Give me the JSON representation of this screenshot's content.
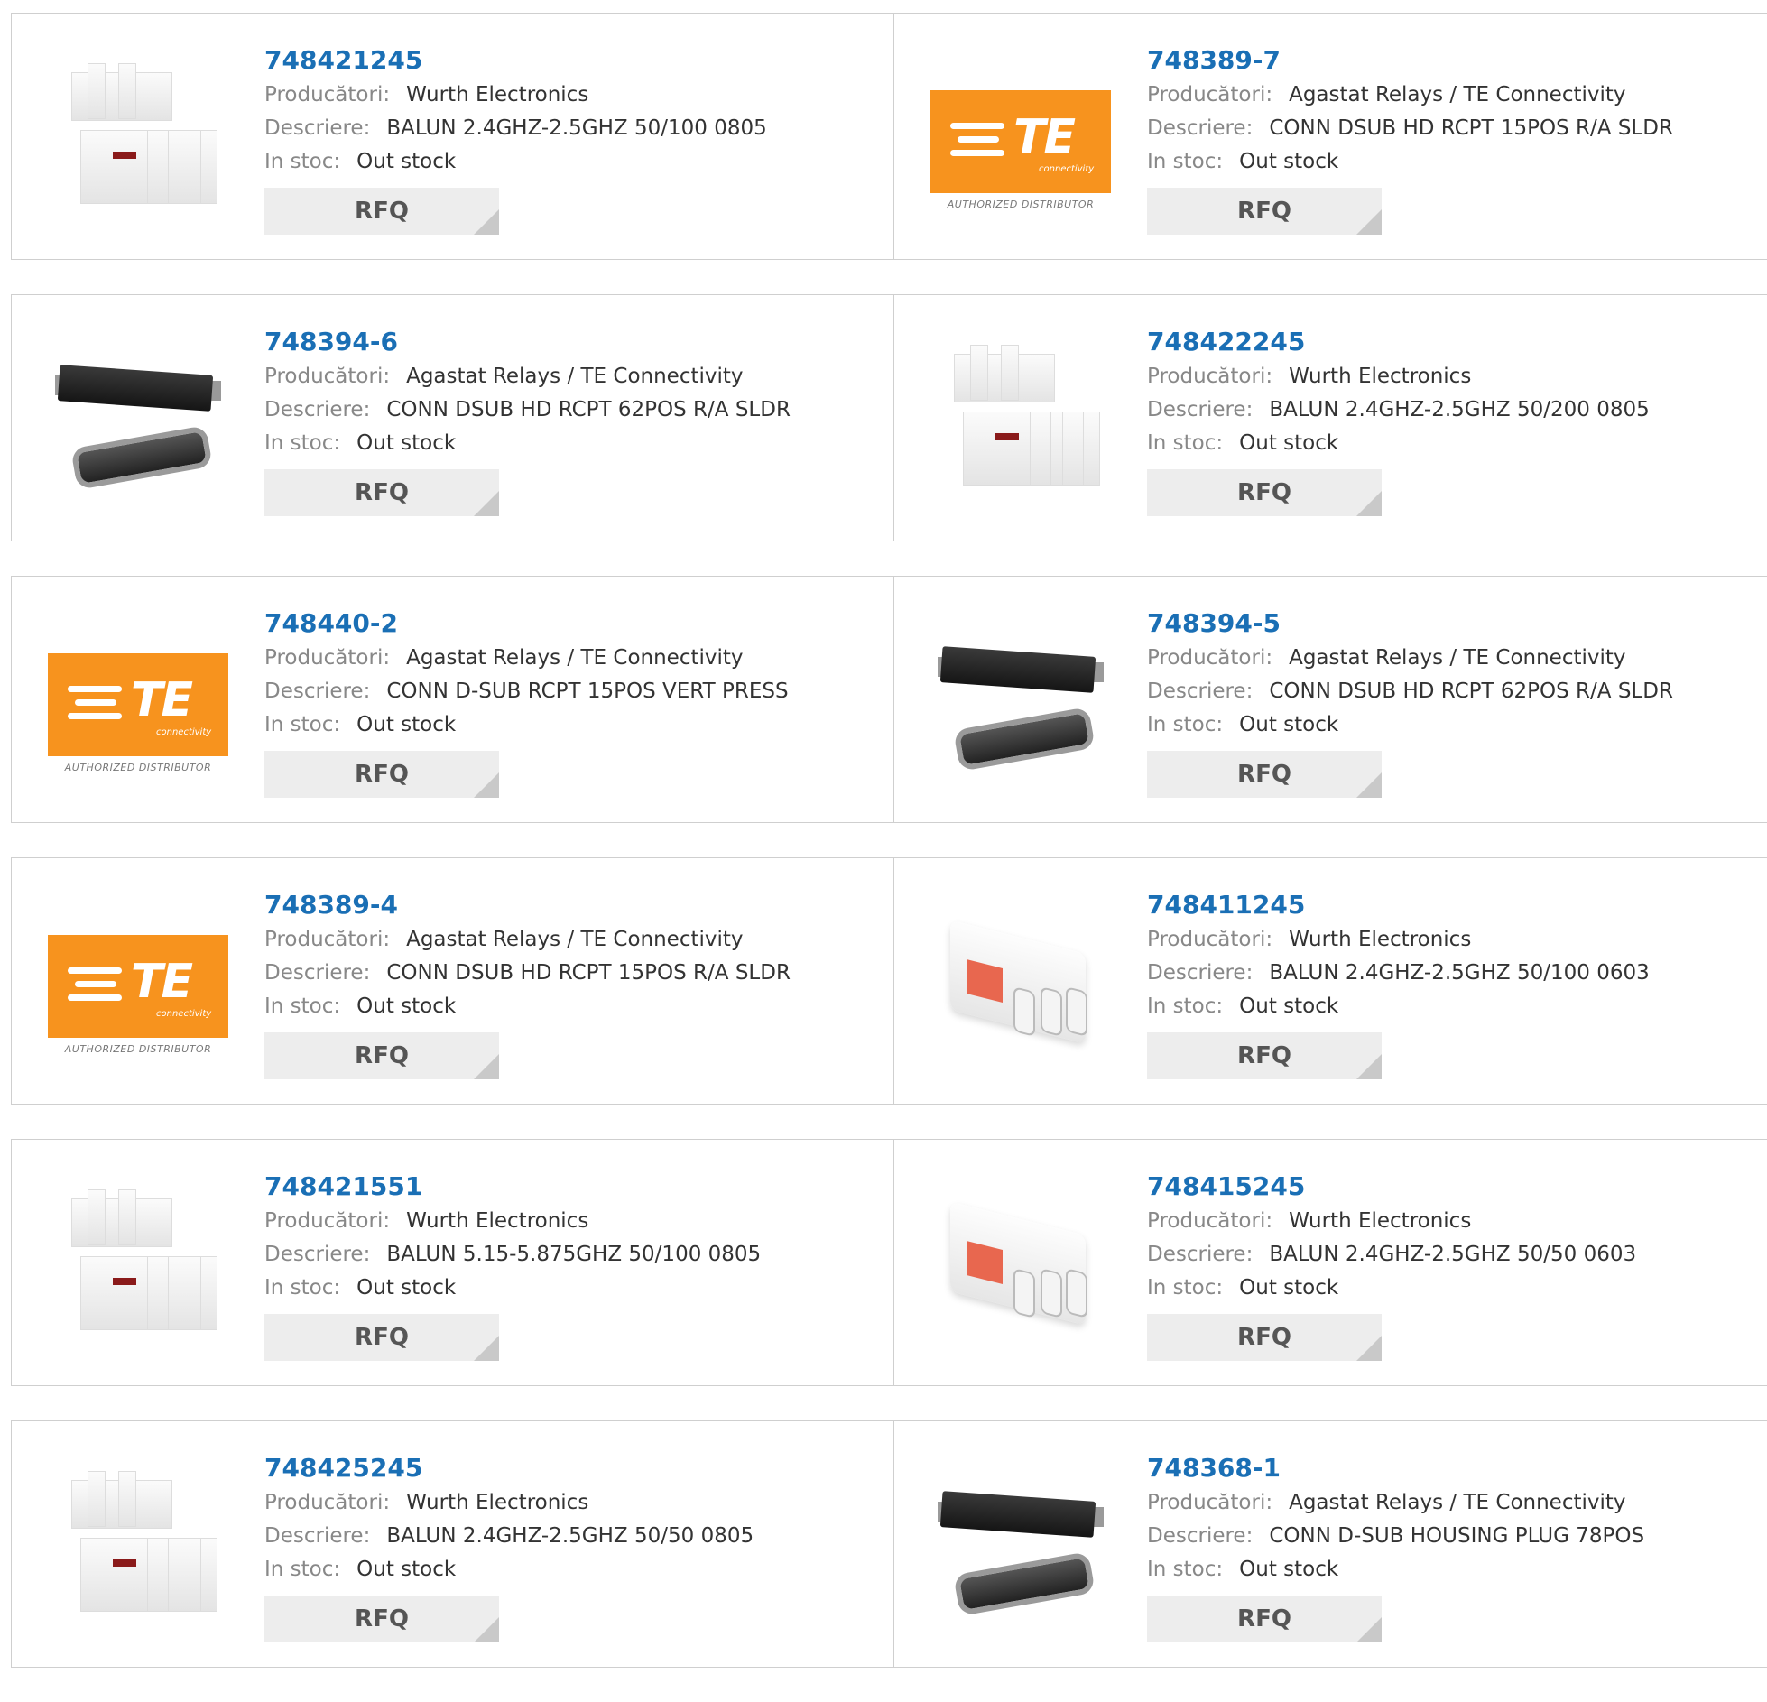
{
  "labels": {
    "manufacturer": "Producători:",
    "description": "Descriere:",
    "stock": "In stoc:",
    "rfq": "RFQ"
  },
  "image_texts": {
    "te_brand": "TE",
    "te_sub": "connectivity",
    "te_authorized": "AUTHORIZED DISTRIBUTOR"
  },
  "colors": {
    "link": "#1a6fb5",
    "te_orange": "#f7931e",
    "rfq_bg": "#ededed"
  },
  "products": [
    {
      "pn": "748421245",
      "manufacturer": "Wurth Electronics",
      "description": "BALUN 2.4GHZ-2.5GHZ 50/100 0805",
      "stock": "Out stock",
      "image": "balun-block"
    },
    {
      "pn": "748389-7",
      "manufacturer": "Agastat Relays / TE Connectivity",
      "description": "CONN DSUB HD RCPT 15POS R/A SLDR",
      "stock": "Out stock",
      "image": "te-logo"
    },
    {
      "pn": "748394-6",
      "manufacturer": "Agastat Relays / TE Connectivity",
      "description": "CONN DSUB HD RCPT 62POS R/A SLDR",
      "stock": "Out stock",
      "image": "dsub-connector"
    },
    {
      "pn": "748422245",
      "manufacturer": "Wurth Electronics",
      "description": "BALUN 2.4GHZ-2.5GHZ 50/200 0805",
      "stock": "Out stock",
      "image": "balun-block"
    },
    {
      "pn": "748440-2",
      "manufacturer": "Agastat Relays / TE Connectivity",
      "description": "CONN D-SUB RCPT 15POS VERT PRESS",
      "stock": "Out stock",
      "image": "te-logo"
    },
    {
      "pn": "748394-5",
      "manufacturer": "Agastat Relays / TE Connectivity",
      "description": "CONN DSUB HD RCPT 62POS R/A SLDR",
      "stock": "Out stock",
      "image": "dsub-connector"
    },
    {
      "pn": "748389-4",
      "manufacturer": "Agastat Relays / TE Connectivity",
      "description": "CONN DSUB HD RCPT 15POS R/A SLDR",
      "stock": "Out stock",
      "image": "te-logo"
    },
    {
      "pn": "748411245",
      "manufacturer": "Wurth Electronics",
      "description": "BALUN 2.4GHZ-2.5GHZ 50/100 0603",
      "stock": "Out stock",
      "image": "balun-chip"
    },
    {
      "pn": "748421551",
      "manufacturer": "Wurth Electronics",
      "description": "BALUN 5.15-5.875GHZ 50/100 0805",
      "stock": "Out stock",
      "image": "balun-block"
    },
    {
      "pn": "748415245",
      "manufacturer": "Wurth Electronics",
      "description": "BALUN 2.4GHZ-2.5GHZ 50/50 0603",
      "stock": "Out stock",
      "image": "balun-chip"
    },
    {
      "pn": "748425245",
      "manufacturer": "Wurth Electronics",
      "description": "BALUN 2.4GHZ-2.5GHZ 50/50 0805",
      "stock": "Out stock",
      "image": "balun-block"
    },
    {
      "pn": "748368-1",
      "manufacturer": "Agastat Relays / TE Connectivity",
      "description": "CONN D-SUB HOUSING PLUG 78POS",
      "stock": "Out stock",
      "image": "dsub-connector"
    }
  ]
}
